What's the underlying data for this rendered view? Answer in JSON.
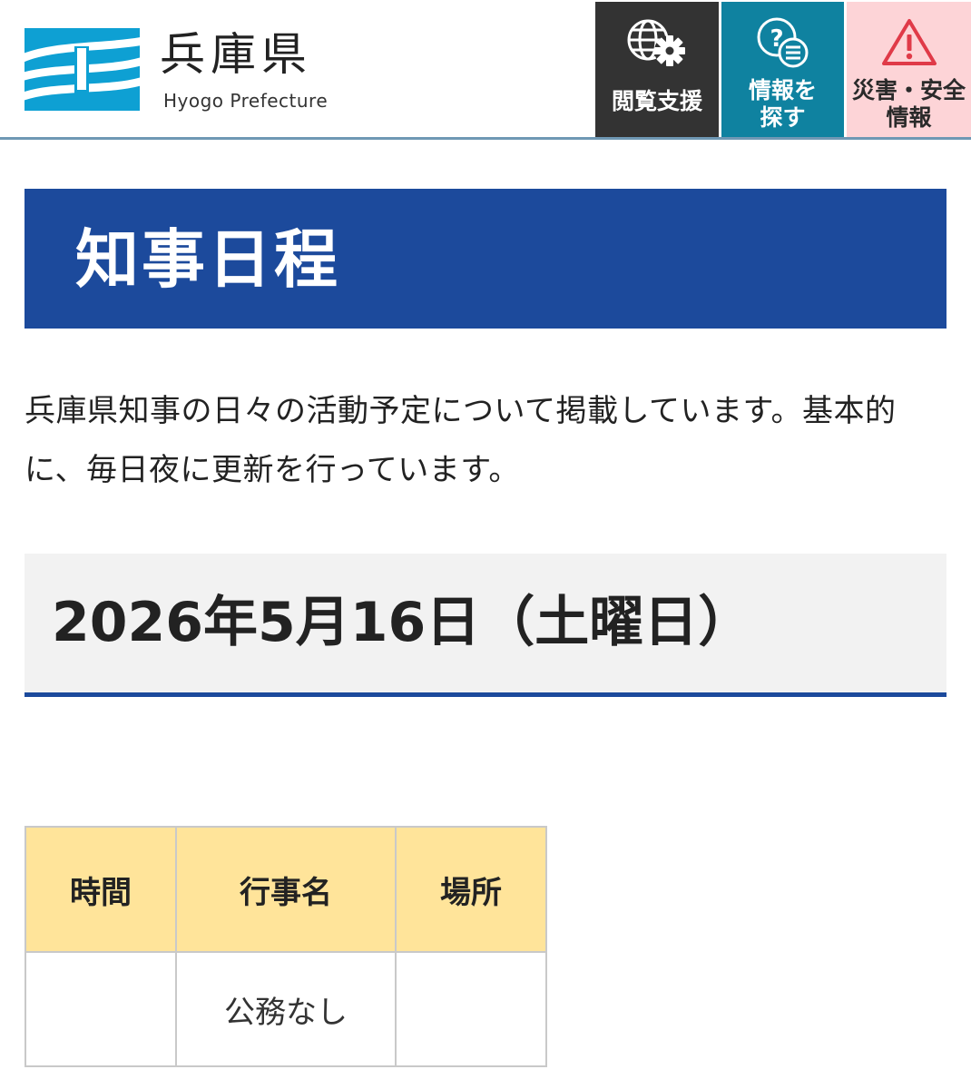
{
  "header": {
    "logo_name": "兵庫県",
    "logo_sub": "Hyogo Prefecture",
    "buttons": {
      "assist": {
        "label": "閲覧支援",
        "icon": "globe-gear-icon"
      },
      "search": {
        "line1": "情報を",
        "line2": "探す",
        "icon": "question-list-icon"
      },
      "disaster": {
        "line1": "災害・安全",
        "line2": "情報",
        "icon": "warning-triangle-icon"
      }
    }
  },
  "page": {
    "title": "知事日程",
    "intro": "兵庫県知事の日々の活動予定について掲載しています。基本的に、毎日夜に更新を行っています。",
    "date_heading": "2026年5月16日（土曜日）"
  },
  "table": {
    "headers": [
      "時間",
      "行事名",
      "場所"
    ],
    "rows": [
      [
        "",
        "公務なし",
        ""
      ]
    ]
  },
  "colors": {
    "title_bar": "#1c4a9c",
    "assist_button": "#333333",
    "search_button": "#0f82a0",
    "disaster_button": "#fdd4d7",
    "table_header": "#ffe49a",
    "logo": "#0ea0d3"
  }
}
